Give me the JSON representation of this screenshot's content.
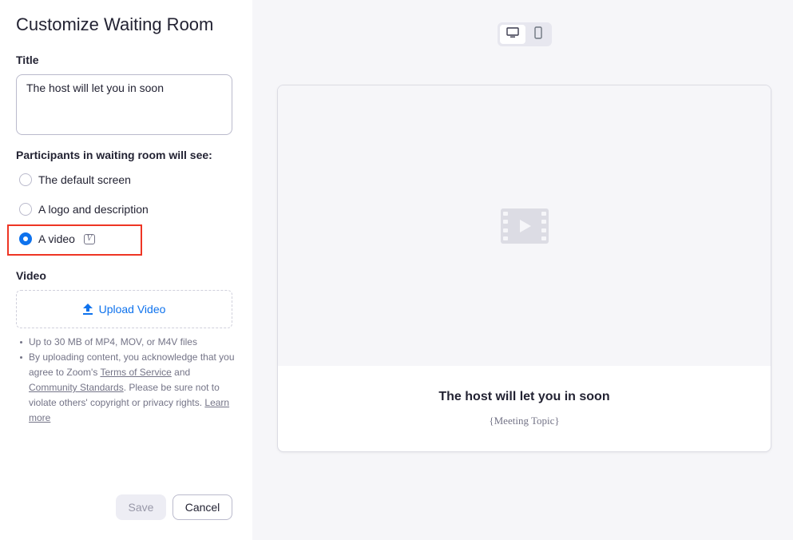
{
  "panel": {
    "heading": "Customize Waiting Room",
    "title_label": "Title",
    "title_value": "The host will let you in soon",
    "participants_label": "Participants in waiting room will see:",
    "options": [
      {
        "label": "The default screen",
        "checked": false
      },
      {
        "label": "A logo and description",
        "checked": false
      },
      {
        "label": "A video",
        "checked": true
      }
    ],
    "video_label": "Video",
    "upload_label": "Upload Video",
    "notes": {
      "line1": "Up to 30 MB of MP4, MOV, or M4V files",
      "line2_pre": "By uploading content, you acknowledge that you agree to Zoom's ",
      "terms_link": "Terms of Service",
      "line2_and": " and ",
      "community_link": "Community Standards",
      "line2_post": ". Please be sure not to violate others' copyright or privacy rights. ",
      "learn_more_link": "Learn more"
    },
    "save_label": "Save",
    "cancel_label": "Cancel"
  },
  "preview": {
    "title": "The host will let you in soon",
    "topic": "{Meeting Topic}"
  },
  "icons": {
    "desktop": "desktop-icon",
    "mobile": "mobile-icon",
    "upload": "upload-arrow-icon",
    "video_placeholder": "video-placeholder-icon",
    "beta": "beta-icon"
  },
  "colors": {
    "accent": "#0e72ed",
    "highlight": "#ee3524"
  }
}
